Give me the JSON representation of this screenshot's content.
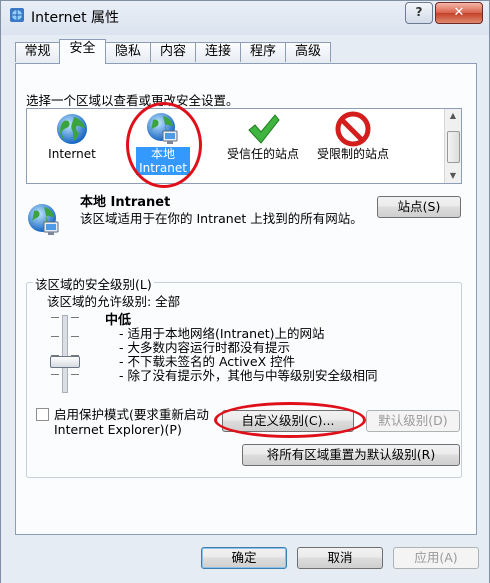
{
  "window": {
    "title": "Internet 属性",
    "close_label": "✕",
    "help_label": "?"
  },
  "tabs": [
    {
      "label": "常规"
    },
    {
      "label": "安全"
    },
    {
      "label": "隐私"
    },
    {
      "label": "内容"
    },
    {
      "label": "连接"
    },
    {
      "label": "程序"
    },
    {
      "label": "高级"
    }
  ],
  "security": {
    "instruction": "选择一个区域以查看或更改安全设置。",
    "zones": [
      {
        "label": "Internet",
        "icon": "globe-icon",
        "selected": false
      },
      {
        "label": "本地 Intranet",
        "icon": "local-intranet-icon",
        "selected": true
      },
      {
        "label": "受信任的站点",
        "icon": "check-icon",
        "selected": false
      },
      {
        "label": "受限制的站点",
        "icon": "restricted-icon",
        "selected": false
      }
    ],
    "detail": {
      "title": "本地 Intranet",
      "description": "该区域适用于在你的 Intranet 上找到的所有网站。",
      "sites_button": "站点(S)"
    },
    "level_group": {
      "legend": "该区域的安全级别(L)",
      "allowed": "该区域的允许级别: 全部",
      "level_name": "中低",
      "level_position": 0.5,
      "bullets": [
        "- 适用于本地网络(Intranet)上的网站",
        "- 大多数内容运行时都没有提示",
        "- 不下载未签名的 ActiveX 控件",
        "- 除了没有提示外，其他与中等级别安全级相同"
      ]
    },
    "protected_mode": {
      "label": "启用保护模式(要求重新启动 Internet Explorer)(P)",
      "checked": false
    },
    "custom_level_button": "自定义级别(C)...",
    "default_level_button": "默认级别(D)",
    "reset_all_button": "将所有区域重置为默认级别(R)"
  },
  "footer": {
    "ok": "确定",
    "cancel": "取消",
    "apply": "应用(A)"
  },
  "colors": {
    "accent": "#3399ff",
    "highlight_circle": "#e0101a"
  }
}
